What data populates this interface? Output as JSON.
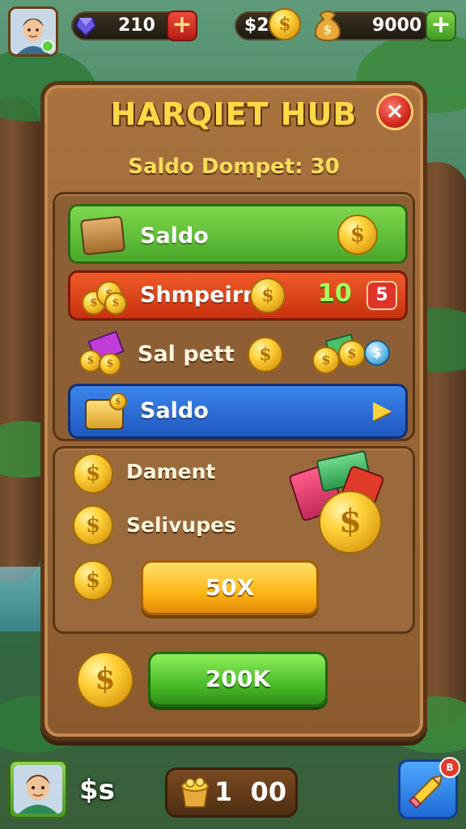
{
  "top_bar": {
    "gems": "210",
    "cash": "$2",
    "gold": "9000"
  },
  "panel": {
    "title": "HARQIET HUB",
    "subtitle": "Saldo Dompet: 30",
    "close_glyph": "×"
  },
  "rows": [
    {
      "label": "Saldo",
      "color": "#5cbf2e"
    },
    {
      "label": "Shmpeirn",
      "color": "#e2491f",
      "badge_value": "10",
      "badge_count": "5"
    },
    {
      "label": "Sal pett"
    },
    {
      "label": "Saldo",
      "color": "#2a6ad0",
      "arrow": "▶"
    }
  ],
  "bonus_section": {
    "items": [
      {
        "label": "Dament"
      },
      {
        "label": "Selivupes"
      }
    ],
    "button_label": "50X"
  },
  "claim_button": {
    "label": "200K"
  },
  "bottom_bar": {
    "currency_label": "$s",
    "amount": "1  00",
    "notification_count": "B"
  },
  "colors": {
    "title_yellow": "#ffd84a",
    "panel_brown": "#8a5a2e",
    "button_green": "#4bbd2a",
    "button_yellow": "#ffb616",
    "close_red": "#d22a1e"
  },
  "icons": [
    "avatar-icon",
    "gem-icon",
    "coin-icon",
    "money-bag-icon",
    "crate-icon",
    "coin-stack-icon",
    "arrow-right-icon",
    "close-icon",
    "pencil-icon",
    "plus-icon"
  ]
}
